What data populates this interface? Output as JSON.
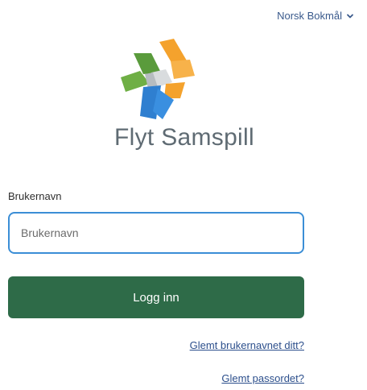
{
  "header": {
    "language_label": "Norsk Bokmål",
    "language_icon": "chevron-down-icon"
  },
  "brand": {
    "name": "Flyt Samspill",
    "logo_icon": "flyt-samspill-logo-icon",
    "colors": {
      "green": "#5a9b3c",
      "orange": "#f4a22d",
      "blue": "#2f7fd0",
      "gray": "#b6bcc0"
    }
  },
  "form": {
    "username_label": "Brukernavn",
    "username_placeholder": "Brukernavn",
    "username_value": "",
    "login_label": "Logg inn",
    "login_color": "#2e6b48",
    "input_border_color": "#3b8ed6"
  },
  "links": {
    "forgot_username": "Glemt brukernavnet ditt?",
    "forgot_password": "Glemt passordet?"
  }
}
